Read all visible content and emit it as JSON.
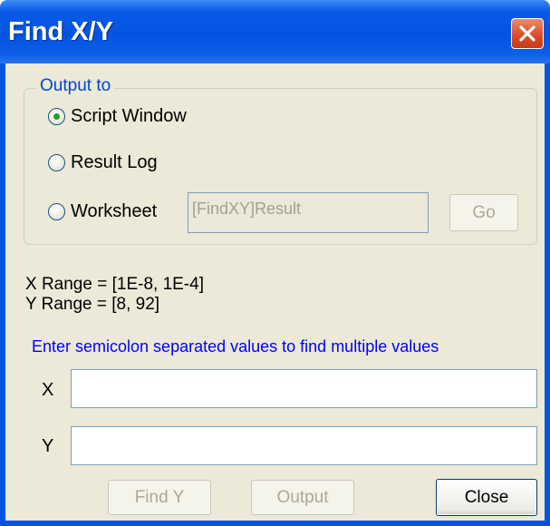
{
  "window": {
    "title": "Find X/Y"
  },
  "output_group": {
    "legend": "Output to",
    "options": [
      {
        "label": "Script Window",
        "checked": true
      },
      {
        "label": "Result Log",
        "checked": false
      },
      {
        "label": "Worksheet",
        "checked": false
      }
    ],
    "worksheet_value": "[FindXY]Result",
    "go_label": "Go"
  },
  "info": {
    "x_range": "X Range = [1E-8, 1E-4]",
    "y_range": "Y Range = [8, 92]",
    "hint": "Enter semicolon separated values to find multiple values"
  },
  "fields": {
    "x_label": "X",
    "x_value": "",
    "y_label": "Y",
    "y_value": ""
  },
  "buttons": {
    "find_y": "Find Y",
    "output": "Output",
    "close": "Close"
  },
  "colors": {
    "titlebar": "#0454e2",
    "dialog_bg": "#ece9d8",
    "legend_text": "#0046d5",
    "hint_text": "#0000ff",
    "radio_selected": "#21a121"
  }
}
